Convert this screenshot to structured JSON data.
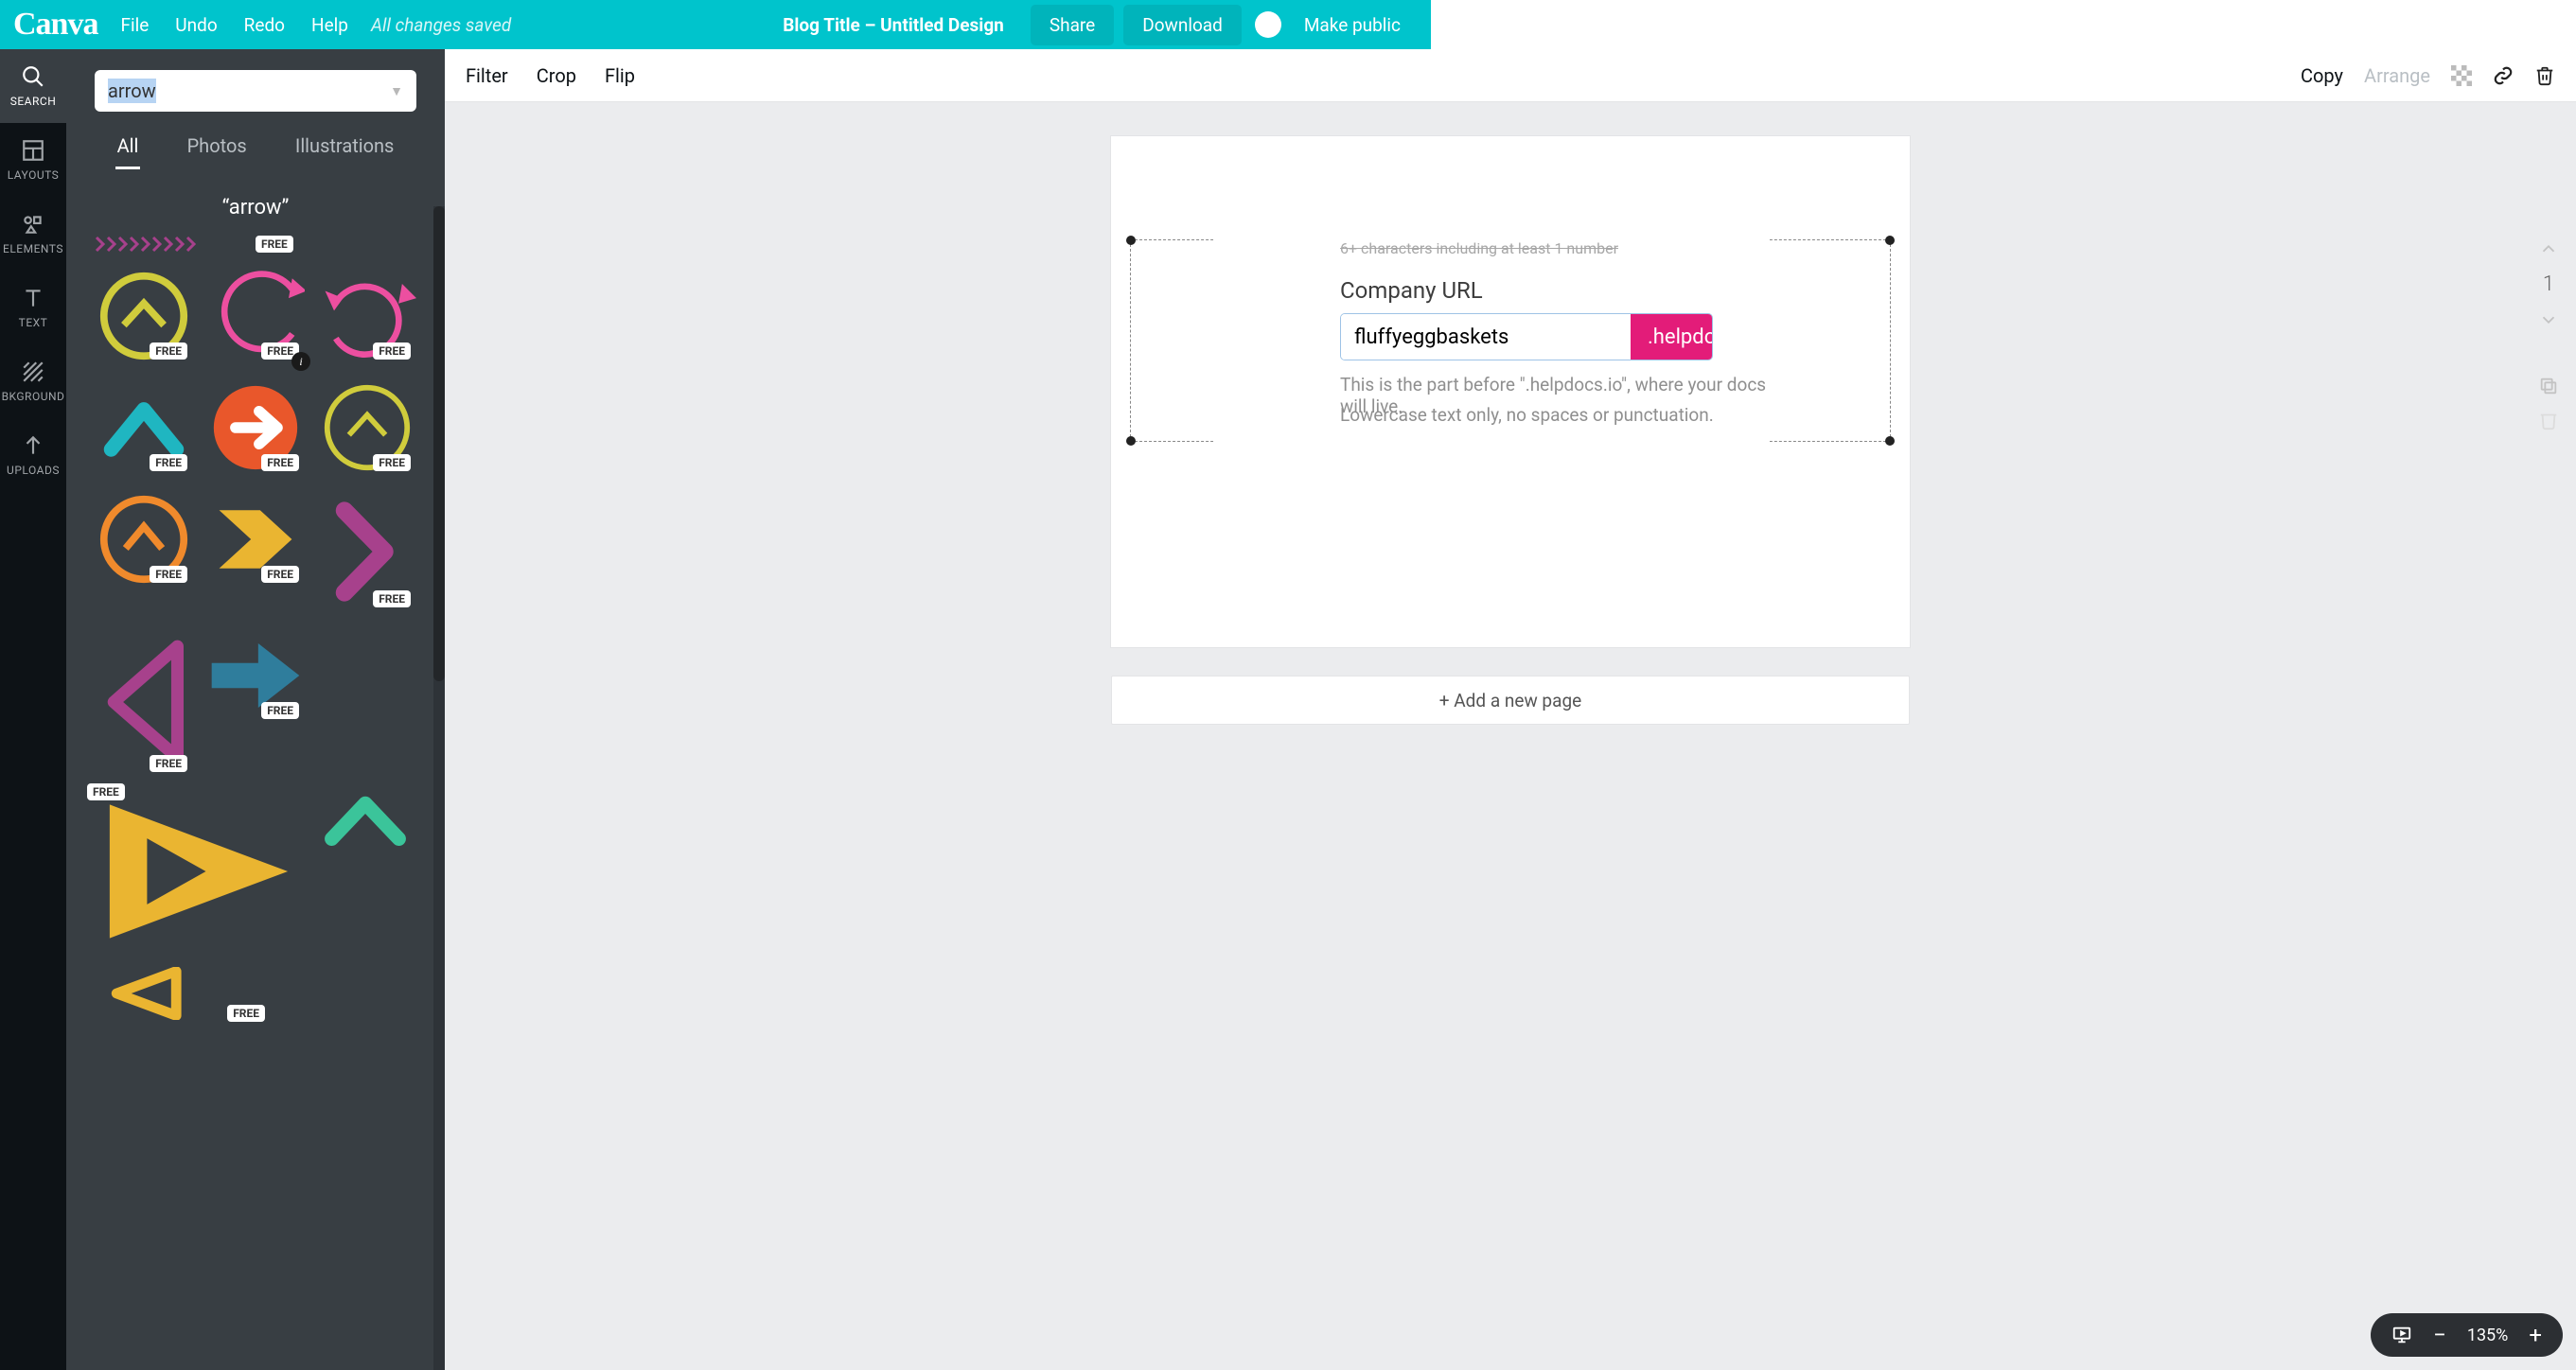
{
  "app": {
    "logo": "Canva"
  },
  "topbar": {
    "menu": {
      "file": "File",
      "undo": "Undo",
      "redo": "Redo",
      "help": "Help"
    },
    "saved_status": "All changes saved",
    "doc_title": "Blog Title – Untitled Design",
    "share_label": "Share",
    "download_label": "Download",
    "make_public_label": "Make public"
  },
  "rail": {
    "search": "SEARCH",
    "layouts": "LAYOUTS",
    "elements": "ELEMENTS",
    "text": "TEXT",
    "background": "BKGROUND",
    "uploads": "UPLOADS"
  },
  "sidebar": {
    "search_value": "arrow",
    "tabs": {
      "all": "All",
      "photos": "Photos",
      "illustrations": "Illustrations"
    },
    "result_heading": "“arrow”",
    "free_label": "FREE"
  },
  "canvas_toolbar": {
    "filter": "Filter",
    "crop": "Crop",
    "flip": "Flip",
    "copy": "Copy",
    "arrange": "Arrange"
  },
  "canvas_content": {
    "clipped_line": "6+ characters including at least 1 number",
    "label": "Company URL",
    "input_value": "fluffyeggbaskets",
    "suffix": ".helpdocs.io",
    "hint1": "This is the part before \".helpdocs.io\", where your docs will live.",
    "hint2": "Lowercase text only, no spaces or punctuation."
  },
  "add_page_label": "+ Add a new page",
  "page_tools": {
    "page_number": "1"
  },
  "zoom": {
    "level": "135%"
  },
  "colors": {
    "brand_teal": "#00c4cc",
    "panel_dark": "#383e43",
    "rail_black": "#0d1216",
    "accent_pink": "#e31c79",
    "canvas_bg": "#ebecee"
  }
}
